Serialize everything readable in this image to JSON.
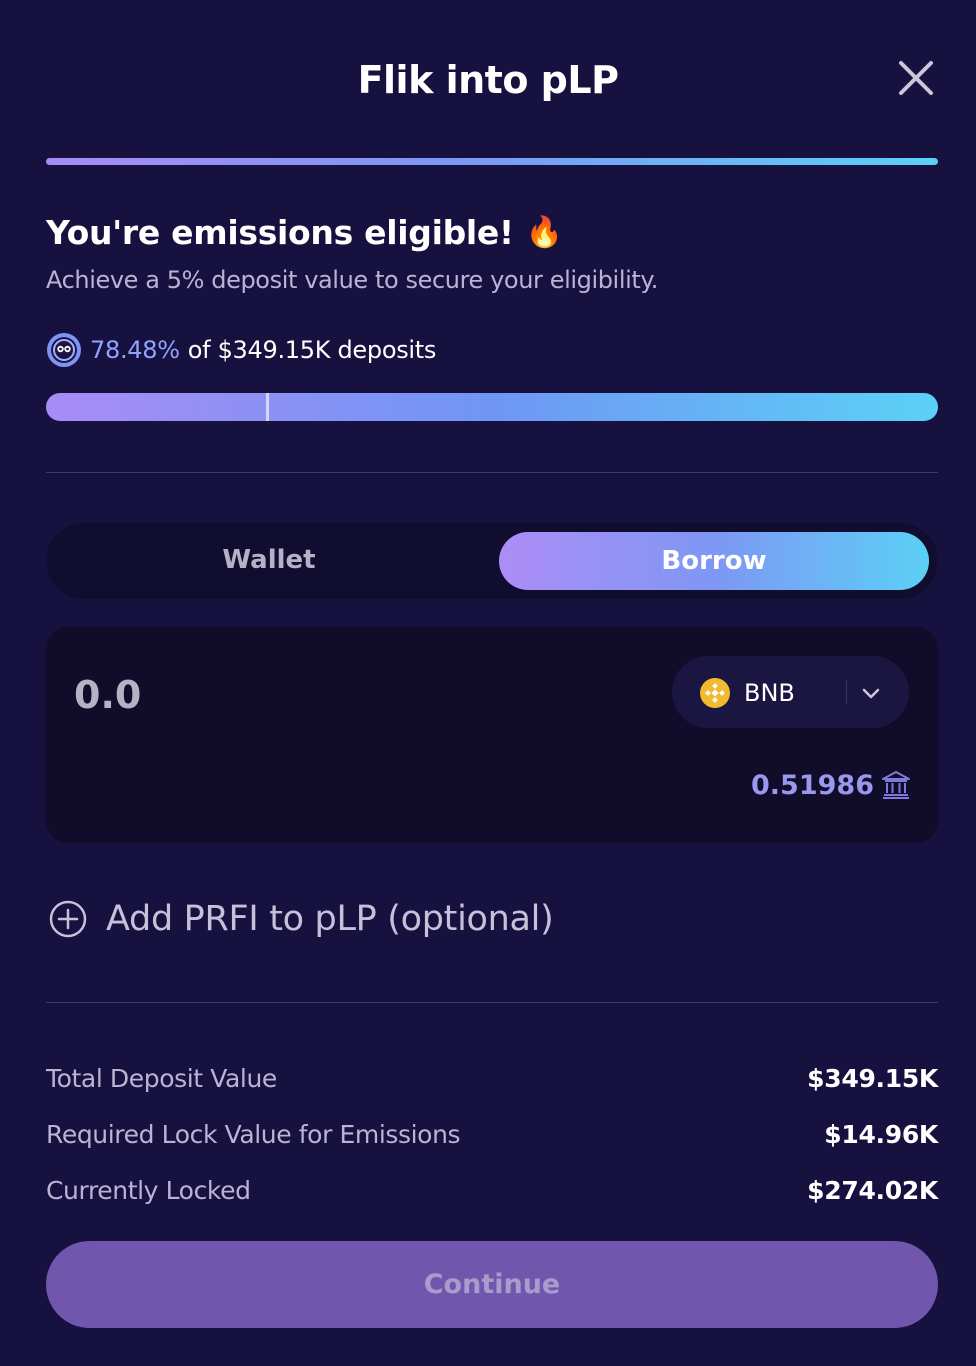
{
  "modal": {
    "title": "Flik into pLP",
    "close_icon": "close-icon"
  },
  "eligibility": {
    "headline": "You're emissions eligible!",
    "headline_emoji": "🔥",
    "subline": "Achieve a 5% deposit value to secure your eligibility.",
    "share_icon": "pool-token-icon",
    "share_percent": "78.48%",
    "share_text": "of $349.15K deposits",
    "marker_fraction": 0.05
  },
  "source_toggle": {
    "options": [
      "Wallet",
      "Borrow"
    ],
    "selected": "Borrow"
  },
  "amount": {
    "placeholder": "0.0",
    "value": "",
    "token": "BNB",
    "token_icon": "bnb-icon",
    "balance": "0.51986",
    "balance_icon": "bank-icon"
  },
  "add_prfi": {
    "label": "Add PRFI to pLP (optional)",
    "icon": "plus-circle-icon"
  },
  "stats": [
    {
      "label": "Total Deposit Value",
      "value": "$349.15K"
    },
    {
      "label": "Required Lock Value for Emissions",
      "value": "$14.96K"
    },
    {
      "label": "Currently Locked",
      "value": "$274.02K"
    }
  ],
  "continue_button": {
    "label": "Continue",
    "enabled": false
  },
  "colors": {
    "background": "#171140",
    "accent_start": "#a88cf5",
    "accent_end": "#5bd1f7",
    "highlight": "#8fa3ff",
    "button_disabled": "#7156ad"
  }
}
